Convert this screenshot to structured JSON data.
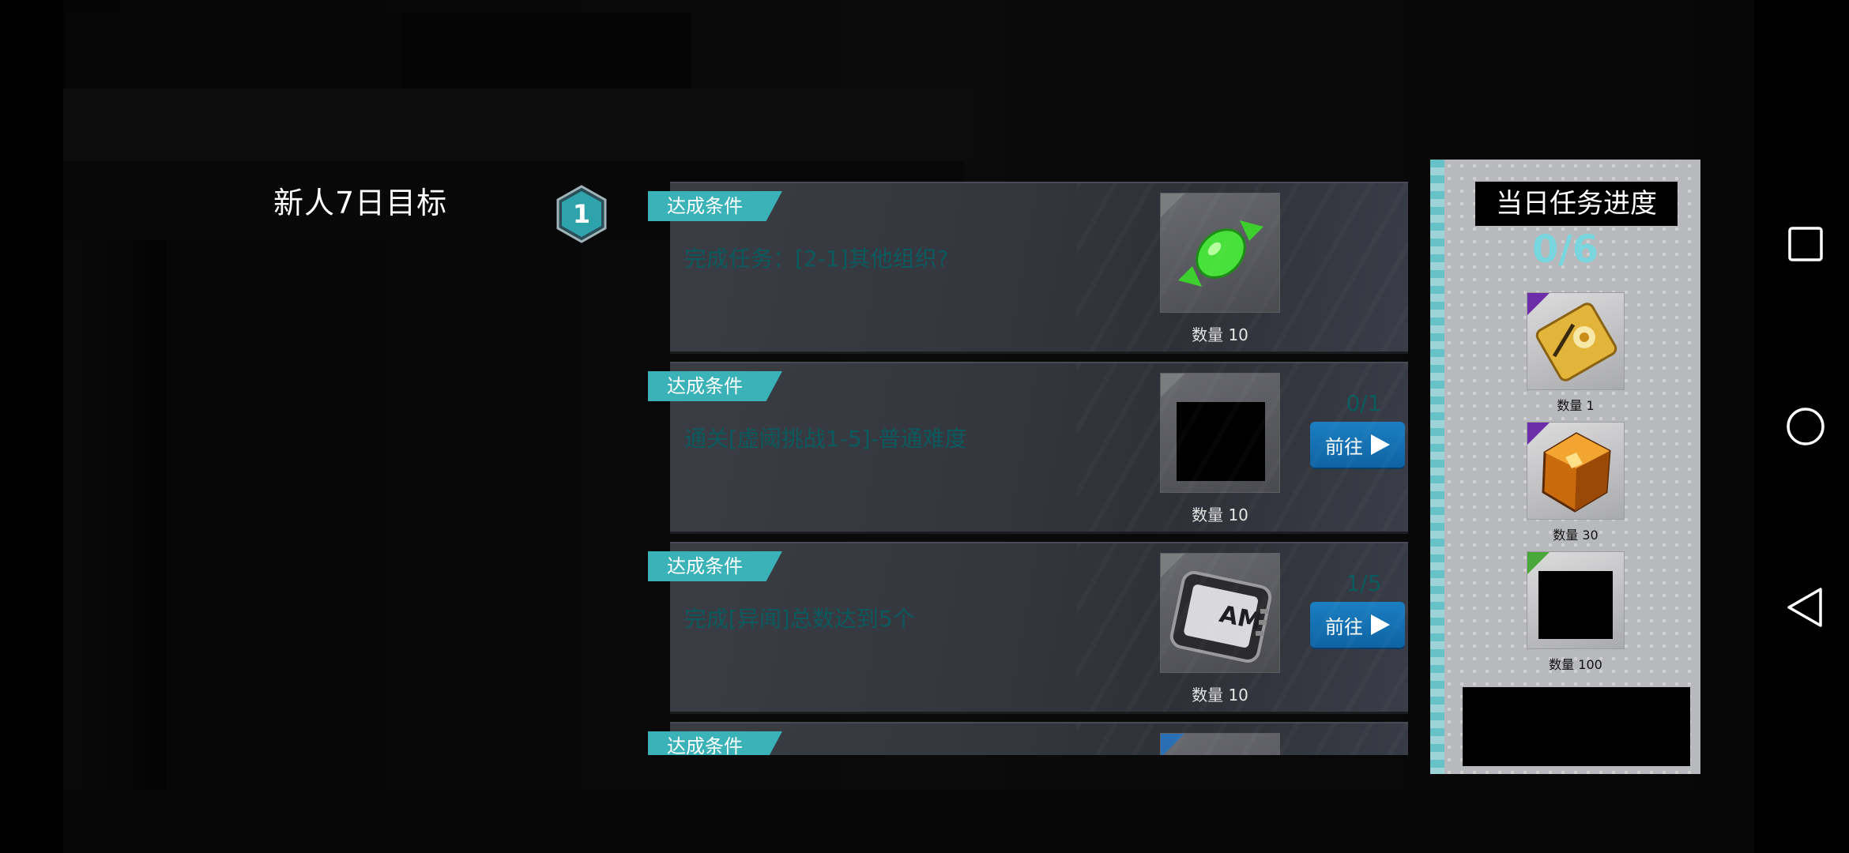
{
  "page": {
    "title": "新人7日目标",
    "day_number": "1"
  },
  "tasks": [
    {
      "condition_label": "达成条件",
      "description": "完成任务：[2-1]其他组织?",
      "reward_icon": "green-candy-icon",
      "reward_quantity": "数量 10",
      "progress": "",
      "go_label": ""
    },
    {
      "condition_label": "达成条件",
      "description": "通关[虚阈挑战1-5]-普通难度",
      "reward_icon": "hidden-reward-icon",
      "reward_quantity": "数量 10",
      "progress": "0/1",
      "go_label": "前往"
    },
    {
      "condition_label": "达成条件",
      "description": "完成[异闻]总数达到5个",
      "reward_icon": "arti-mold-chip-icon",
      "reward_quantity": "数量 10",
      "progress": "1/5",
      "go_label": "前往"
    },
    {
      "condition_label": "达成条件"
    }
  ],
  "daily_progress": {
    "title": "当日任务进度",
    "count": "0/6",
    "rewards": [
      {
        "icon": "gold-ticket-icon",
        "quantity": "数量 1"
      },
      {
        "icon": "amber-cube-icon",
        "quantity": "数量 30"
      },
      {
        "icon": "hidden-reward-icon",
        "quantity": "数量 100"
      }
    ]
  },
  "system_nav": {
    "icons": [
      "recent-apps-icon",
      "home-icon",
      "back-icon"
    ]
  },
  "colors": {
    "accent_teal": "#3ab2b8",
    "button_blue": "#1b7fc2",
    "progress_cyan": "#7ad6de",
    "desc_text": "#0b5a5e"
  }
}
